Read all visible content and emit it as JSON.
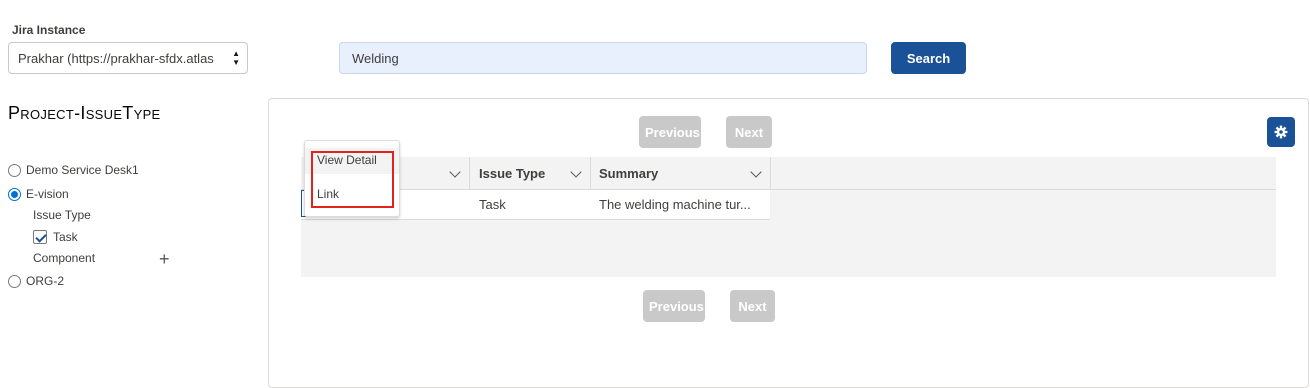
{
  "filter": {
    "jira_instance_label": "Jira Instance",
    "jira_instance_value": "Prakhar (https://prakhar-sfdx.atlas",
    "search_value": "Welding",
    "search_button": "Search"
  },
  "sidebar": {
    "title": "Project-IssueType",
    "projects": [
      {
        "label": "Demo Service Desk1",
        "selected": false
      },
      {
        "label": "E-vision",
        "selected": true
      },
      {
        "label": "ORG-2",
        "selected": false
      }
    ],
    "issue_type_heading": "Issue Type",
    "issue_types": [
      {
        "label": "Task",
        "checked": true
      }
    ],
    "component_heading": "Component"
  },
  "results": {
    "pager_top": {
      "previous": "Previous",
      "next": "Next"
    },
    "pager_bottom": {
      "previous": "Previous",
      "next": "Next"
    },
    "columns": {
      "issue_type": "Issue Type",
      "summary": "Summary"
    },
    "rows": [
      {
        "issue_type": "Task",
        "summary": "The welding machine tur..."
      }
    ],
    "row_menu": {
      "view_detail": "View Detail",
      "link": "Link"
    }
  },
  "colors": {
    "brand": "#1b5297",
    "highlight": "#e2231a",
    "disabled": "#c9c9c9"
  },
  "icons": {
    "settings": "gear-icon",
    "add": "plus-icon",
    "sort": "chevron-down-icon"
  }
}
